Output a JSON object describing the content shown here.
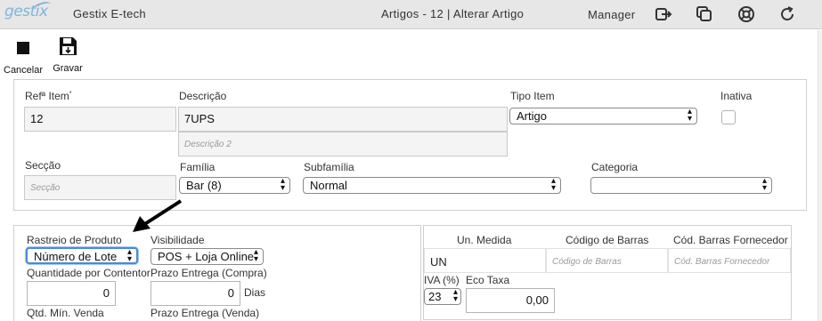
{
  "app": {
    "logo": "gestix",
    "name": "Gestix E-tech",
    "title": "Artigos - 12 | Alterar Artigo",
    "user": "Manager"
  },
  "topbar_icons": [
    "logout-icon",
    "windows-icon",
    "help-lifebuoy-icon",
    "refresh-icon"
  ],
  "toolbar": {
    "cancel": "Cancelar",
    "save": "Gravar"
  },
  "form": {
    "ref_label": "Refª Item",
    "ref_required_mark": "*",
    "ref_value": "12",
    "desc_label": "Descrição",
    "desc_value": "7UPS",
    "desc2_placeholder": "Descrição 2",
    "type_label": "Tipo Item",
    "type_value": "Artigo",
    "inactive_label": "Inativa",
    "inactive_checked": false,
    "section_label": "Secção",
    "section_placeholder": "Secção",
    "family_label": "Família",
    "family_value": "Bar (8)",
    "subfamily_label": "Subfamília",
    "subfamily_value": "Normal",
    "category_label": "Categoria",
    "category_value": ""
  },
  "stock": {
    "tracking_label": "Rastreio de Produto",
    "tracking_value": "Número de Lote",
    "visibility_label": "Visibilidade",
    "visibility_value": "POS + Loja Online",
    "qty_per_container_label": "Quantidade por Contentor",
    "qty_per_container_value": "0",
    "lead_time_buy_label": "Prazo Entrega (Compra)",
    "lead_time_buy_value": "0",
    "lead_time_buy_unit": "Dias",
    "min_sale_qty_label": "Qtd. Mín. Venda",
    "lead_time_sell_label": "Prazo Entrega (Venda)"
  },
  "units": {
    "columns": [
      "Un. Medida",
      "Código de Barras",
      "Cód. Barras Fornecedor"
    ],
    "row": {
      "unit": "UN",
      "barcode_placeholder": "Código de Barras",
      "supplier_barcode_placeholder": "Cód. Barras Fornecedor"
    },
    "vat_label": "IVA (%)",
    "vat_value": "23",
    "eco_tax_label": "Eco Taxa",
    "eco_tax_value": "0,00"
  }
}
